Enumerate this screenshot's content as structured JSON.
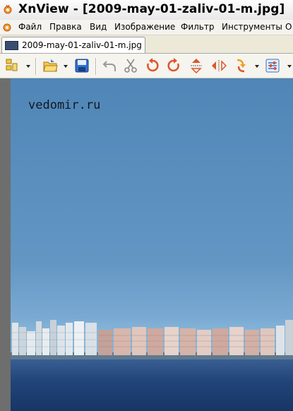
{
  "window": {
    "title": "XnView - [2009-may-01-zaliv-01-m.jpg]"
  },
  "menu": {
    "items": [
      "Файл",
      "Правка",
      "Вид",
      "Изображение",
      "Фильтр",
      "Инструменты",
      "О"
    ]
  },
  "tabs": [
    {
      "label": "2009-may-01-zaliv-01-m.jpg"
    }
  ],
  "toolbar": {
    "buttons": [
      "browser-icon",
      "open-icon",
      "save-icon",
      "undo-icon",
      "cut-icon",
      "rotate-left-icon",
      "rotate-right-icon",
      "flip-vertical-icon",
      "flip-horizontal-icon",
      "transform-icon",
      "adjust-icon"
    ]
  },
  "image": {
    "watermark": "vedomir.ru"
  },
  "colors": {
    "sky": "#5b90bf",
    "water": "#22457a",
    "viewer_bg": "#6e6e6e"
  }
}
